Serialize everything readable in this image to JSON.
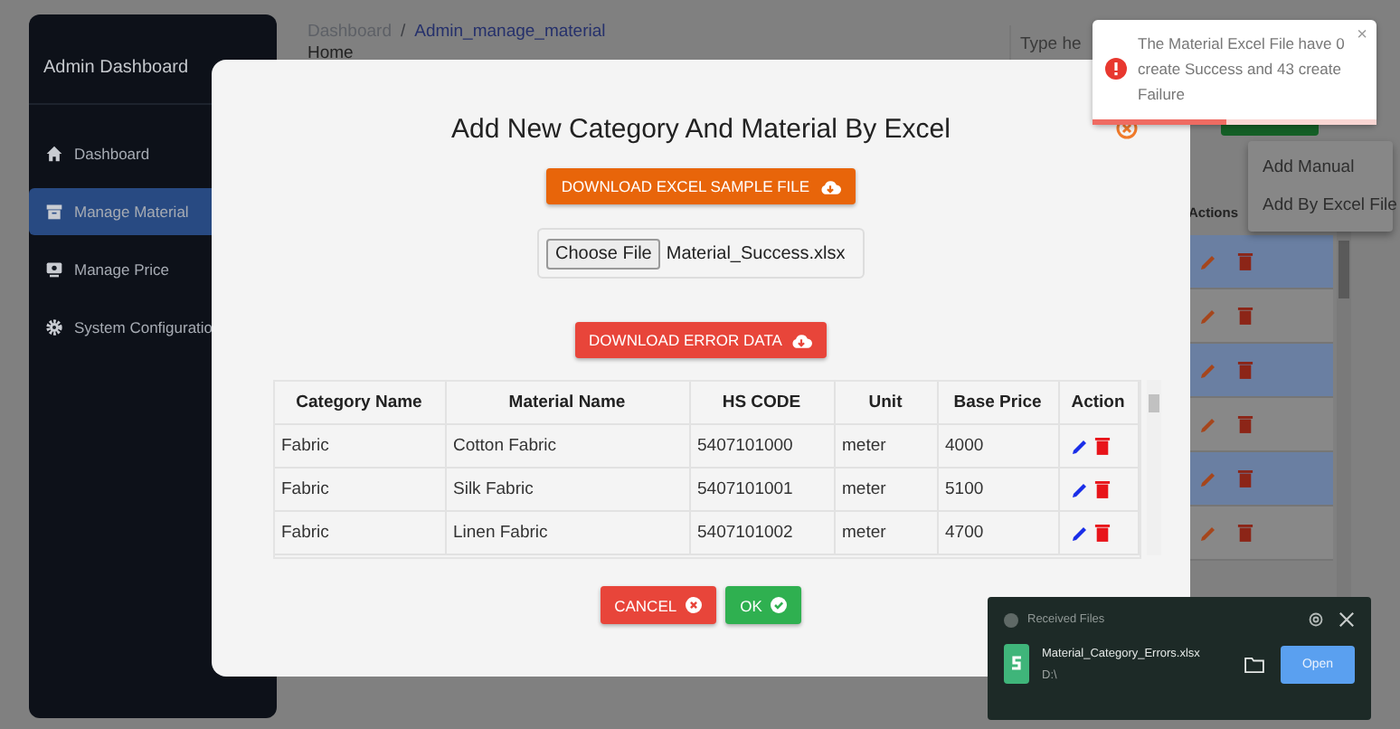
{
  "sidebar": {
    "title": "Admin Dashboard",
    "items": [
      {
        "label": "Dashboard",
        "selected": false
      },
      {
        "label": "Manage Material",
        "selected": true
      },
      {
        "label": "Manage Price",
        "selected": false
      },
      {
        "label": "System Configuratio",
        "selected": false
      }
    ]
  },
  "page": {
    "breadcrumb": [
      "Dashboard",
      "Admin_manage_material"
    ],
    "separator": "/",
    "heading": "Home",
    "search": {
      "placeholder": "Type he"
    },
    "menu": [
      "Add Manual",
      "Add By Excel File"
    ],
    "table": {
      "columns": [
        "Actions"
      ],
      "rows": [
        {
          "highlighted": true
        },
        {
          "highlighted": false
        },
        {
          "highlighted": true
        },
        {
          "highlighted": false
        },
        {
          "highlighted": true
        },
        {
          "highlighted": false
        }
      ]
    }
  },
  "modal": {
    "title": "Add New Category And Material By Excel",
    "sample_button": "DOWNLOAD EXCEL SAMPLE FILE",
    "file_input": {
      "button": "Choose File",
      "value": "Material_Success.xlsx"
    },
    "error_button": "DOWNLOAD ERROR DATA",
    "table": {
      "columns": [
        "Category Name",
        "Material Name",
        "HS CODE",
        "Unit",
        "Base Price",
        "Action"
      ],
      "rows": [
        [
          "Fabric",
          "Cotton Fabric",
          "5407101000",
          "meter",
          "4000"
        ],
        [
          "Fabric",
          "Silk Fabric",
          "5407101001",
          "meter",
          "5100"
        ],
        [
          "Fabric",
          "Linen Fabric",
          "5407101002",
          "meter",
          "4700"
        ]
      ]
    },
    "cancel": "CANCEL",
    "ok": "OK"
  },
  "toast": {
    "message": "The Material Excel File have 0 create Success and 43 create Failure",
    "close": "×",
    "level": 0.47
  },
  "received": {
    "title": "Received Files",
    "file": "Material_Category_Errors.xlsx",
    "path": "D:\\",
    "open": "Open"
  }
}
